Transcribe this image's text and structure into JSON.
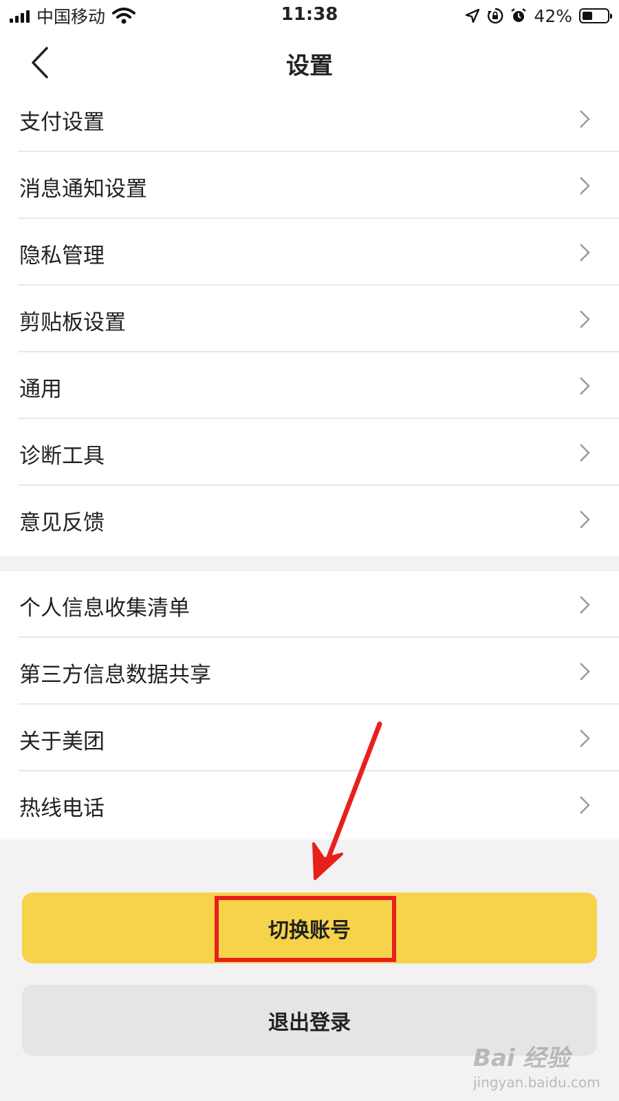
{
  "status_bar": {
    "carrier": "中国移动",
    "time": "11:38",
    "battery_percent": "42%",
    "battery_level": 0.42,
    "icons": [
      "signal-icon",
      "wifi-icon",
      "location-icon",
      "rotation-lock-icon",
      "alarm-icon",
      "battery-icon"
    ]
  },
  "nav": {
    "title": "设置",
    "back_icon": "chevron-left-icon"
  },
  "group1": {
    "items": [
      {
        "label": "支付设置"
      },
      {
        "label": "消息通知设置"
      },
      {
        "label": "隐私管理"
      },
      {
        "label": "剪贴板设置"
      },
      {
        "label": "通用"
      },
      {
        "label": "诊断工具"
      },
      {
        "label": "意见反馈"
      }
    ]
  },
  "group2": {
    "items": [
      {
        "label": "个人信息收集清单"
      },
      {
        "label": "第三方信息数据共享"
      },
      {
        "label": "关于美团"
      },
      {
        "label": "热线电话"
      }
    ]
  },
  "buttons": {
    "switch_account": "切换账号",
    "logout": "退出登录"
  },
  "annotation": {
    "color": "#e8201c"
  },
  "watermark": {
    "main": "Bai 经验",
    "sub": "jingyan.baidu.com"
  },
  "colors": {
    "accent_yellow": "#f6d34a",
    "secondary_gray": "#e5e5e5",
    "background": "#f2f2f2"
  }
}
